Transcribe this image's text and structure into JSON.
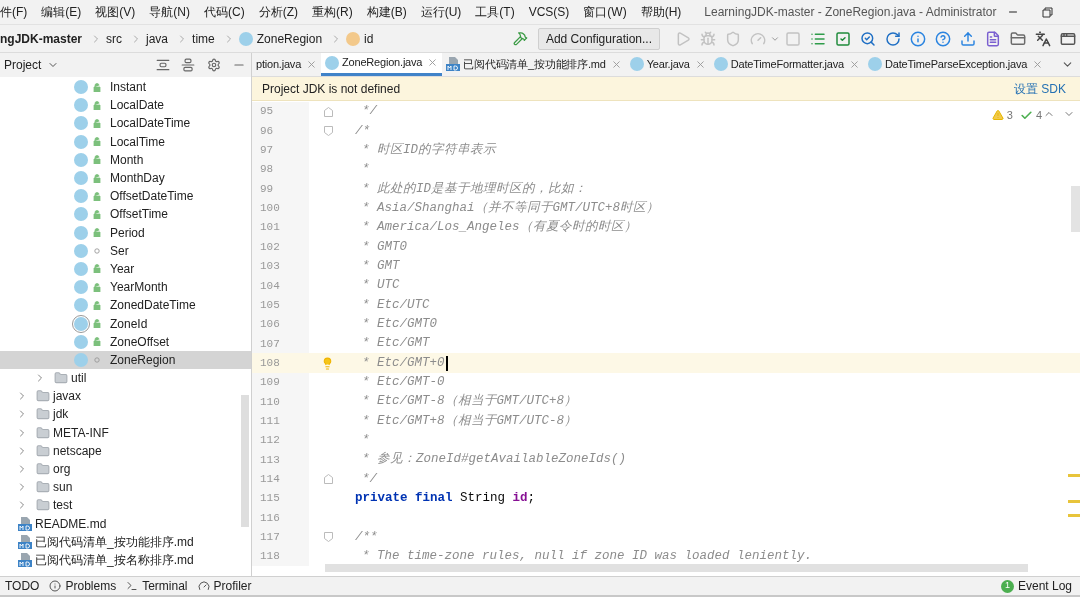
{
  "menu": [
    "件(F)",
    "编辑(E)",
    "视图(V)",
    "导航(N)",
    "代码(C)",
    "分析(Z)",
    "重构(R)",
    "构建(B)",
    "运行(U)",
    "工具(T)",
    "VCS(S)",
    "窗口(W)",
    "帮助(H)"
  ],
  "window": {
    "title": "LearningJDK-master - ZoneRegion.java - Administrator"
  },
  "breadcrumbs": [
    {
      "label": "ngJDK-master",
      "kind": "project"
    },
    {
      "label": "src",
      "kind": "dir"
    },
    {
      "label": "java",
      "kind": "dir"
    },
    {
      "label": "time",
      "kind": "dir"
    },
    {
      "label": "ZoneRegion",
      "kind": "class"
    },
    {
      "label": "id",
      "kind": "field"
    }
  ],
  "toolbar": {
    "config_button": "Add Configuration...",
    "tools": [
      {
        "kind": "run",
        "disabled": true
      },
      {
        "kind": "debug",
        "disabled": true
      },
      {
        "kind": "coverage",
        "disabled": true
      },
      {
        "kind": "profile",
        "disabled": true
      },
      {
        "kind": "stop",
        "disabled": true
      },
      {
        "kind": "list",
        "disabled": false
      },
      {
        "kind": "check",
        "disabled": false
      },
      {
        "kind": "inspect",
        "disabled": false
      },
      {
        "kind": "refresh",
        "disabled": false
      },
      {
        "kind": "info",
        "disabled": false
      },
      {
        "kind": "help",
        "disabled": false
      },
      {
        "kind": "upload",
        "disabled": false
      },
      {
        "kind": "doc",
        "disabled": false
      },
      {
        "kind": "folder",
        "disabled": false
      },
      {
        "kind": "translate",
        "disabled": false
      },
      {
        "kind": "terminal",
        "disabled": false
      }
    ]
  },
  "project_panel": {
    "title": "Project",
    "classes": [
      {
        "label": "Instant",
        "kind": "class",
        "public": true,
        "selected": false
      },
      {
        "label": "LocalDate",
        "kind": "class",
        "public": true,
        "selected": false
      },
      {
        "label": "LocalDateTime",
        "kind": "class",
        "public": true,
        "selected": false
      },
      {
        "label": "LocalTime",
        "kind": "class",
        "public": true,
        "selected": false
      },
      {
        "label": "Month",
        "kind": "enum",
        "public": true,
        "selected": false
      },
      {
        "label": "MonthDay",
        "kind": "class",
        "public": true,
        "selected": false
      },
      {
        "label": "OffsetDateTime",
        "kind": "class",
        "public": true,
        "selected": false
      },
      {
        "label": "OffsetTime",
        "kind": "class",
        "public": true,
        "selected": false
      },
      {
        "label": "Period",
        "kind": "class",
        "public": true,
        "selected": false
      },
      {
        "label": "Ser",
        "kind": "class",
        "public": false,
        "selected": false
      },
      {
        "label": "Year",
        "kind": "class",
        "public": true,
        "selected": false
      },
      {
        "label": "YearMonth",
        "kind": "class",
        "public": true,
        "selected": false
      },
      {
        "label": "ZonedDateTime",
        "kind": "class",
        "public": true,
        "selected": false
      },
      {
        "label": "ZoneId",
        "kind": "abstract",
        "public": true,
        "selected": false
      },
      {
        "label": "ZoneOffset",
        "kind": "class",
        "public": true,
        "selected": false
      },
      {
        "label": "ZoneRegion",
        "kind": "class",
        "public": false,
        "selected": true
      }
    ],
    "sub_folders": [
      {
        "label": "util",
        "expanded": false
      }
    ],
    "folders": [
      {
        "label": "javax",
        "expanded": false
      },
      {
        "label": "jdk",
        "expanded": false
      },
      {
        "label": "META-INF",
        "expanded": false
      },
      {
        "label": "netscape",
        "expanded": false
      },
      {
        "label": "org",
        "expanded": false
      },
      {
        "label": "sun",
        "expanded": false
      },
      {
        "label": "test",
        "expanded": false
      }
    ],
    "files": [
      "README.md",
      "已阅代码清单_按功能排序.md",
      "已阅代码清单_按名称排序.md"
    ]
  },
  "tabs": [
    {
      "label": "ption.java",
      "selected": false
    },
    {
      "label": "ZoneRegion.java",
      "kind": "class",
      "selected": true
    },
    {
      "label": "已阅代码清单_按功能排序.md",
      "kind": "md",
      "selected": false
    },
    {
      "label": "Year.java",
      "kind": "class",
      "selected": false
    },
    {
      "label": "DateTimeFormatter.java",
      "kind": "class",
      "selected": false
    },
    {
      "label": "DateTimeParseException.java",
      "kind": "class",
      "selected": false
    }
  ],
  "banner": {
    "message": "Project JDK is not defined",
    "action": "设置 SDK"
  },
  "inspections": {
    "warnings": "3",
    "weak_warnings": "4"
  },
  "lines": [
    {
      "number": "95",
      "kind": "comment",
      "fold_start": false,
      "fold_end": true,
      "current": false,
      "text": "*/"
    },
    {
      "number": "96",
      "kind": "comment_open",
      "fold_start": true,
      "fold_end": false,
      "current": false,
      "text": "/*"
    },
    {
      "number": "97",
      "kind": "comment",
      "fold_start": false,
      "fold_end": false,
      "current": false,
      "text": "* 时区ID的字符串表示"
    },
    {
      "number": "98",
      "kind": "comment",
      "fold_start": false,
      "fold_end": false,
      "current": false,
      "text": "*"
    },
    {
      "number": "99",
      "kind": "comment",
      "fold_start": false,
      "fold_end": false,
      "current": false,
      "text": "* 此处的ID是基于地理时区的，比如："
    },
    {
      "number": "100",
      "kind": "comment",
      "fold_start": false,
      "fold_end": false,
      "current": false,
      "text": "* Asia/Shanghai（并不等同于GMT/UTC+8时区）"
    },
    {
      "number": "101",
      "kind": "comment",
      "fold_start": false,
      "fold_end": false,
      "current": false,
      "text": "* America/Los_Angeles（有夏令时的时区）"
    },
    {
      "number": "102",
      "kind": "comment",
      "fold_start": false,
      "fold_end": false,
      "current": false,
      "text": "* GMT0"
    },
    {
      "number": "103",
      "kind": "comment",
      "fold_start": false,
      "fold_end": false,
      "current": false,
      "text": "* GMT"
    },
    {
      "number": "104",
      "kind": "comment",
      "fold_start": false,
      "fold_end": false,
      "current": false,
      "text": "* UTC"
    },
    {
      "number": "105",
      "kind": "comment",
      "fold_start": false,
      "fold_end": false,
      "current": false,
      "text": "* Etc/UTC"
    },
    {
      "number": "106",
      "kind": "comment",
      "fold_start": false,
      "fold_end": false,
      "current": false,
      "text": "* Etc/GMT0"
    },
    {
      "number": "107",
      "kind": "comment",
      "fold_start": false,
      "fold_end": false,
      "current": false,
      "text": "* Etc/GMT"
    },
    {
      "number": "108",
      "kind": "comment",
      "fold_start": false,
      "fold_end": false,
      "current": true,
      "text": "* Etc/GMT+0"
    },
    {
      "number": "109",
      "kind": "comment",
      "fold_start": false,
      "fold_end": false,
      "current": false,
      "text": "* Etc/GMT-0"
    },
    {
      "number": "110",
      "kind": "comment",
      "fold_start": false,
      "fold_end": false,
      "current": false,
      "text": "* Etc/GMT-8（相当于GMT/UTC+8）"
    },
    {
      "number": "111",
      "kind": "comment",
      "fold_start": false,
      "fold_end": false,
      "current": false,
      "text": "* Etc/GMT+8（相当于GMT/UTC-8）"
    },
    {
      "number": "112",
      "kind": "comment",
      "fold_start": false,
      "fold_end": false,
      "current": false,
      "text": "*"
    },
    {
      "number": "113",
      "kind": "comment",
      "fold_start": false,
      "fold_end": false,
      "current": false,
      "text": "* 参见：ZoneId#getAvailableZoneIds()"
    },
    {
      "number": "114",
      "kind": "comment",
      "fold_start": false,
      "fold_end": true,
      "current": false,
      "text": "*/"
    },
    {
      "number": "115",
      "kind": "code",
      "fold_start": false,
      "fold_end": false,
      "current": false,
      "tokens": [
        {
          "text": "private final ",
          "kind": "keyword"
        },
        {
          "text": "String ",
          "kind": "plain"
        },
        {
          "text": "id",
          "kind": "field"
        },
        {
          "text": ";",
          "kind": "plain"
        }
      ]
    },
    {
      "number": "116",
      "kind": "code",
      "fold_start": false,
      "fold_end": false,
      "current": false
    },
    {
      "number": "117",
      "kind": "comment_open",
      "fold_start": true,
      "fold_end": false,
      "current": false,
      "text": "/**"
    },
    {
      "number": "118",
      "kind": "comment",
      "fold_start": false,
      "fold_end": false,
      "current": false,
      "text": "* The time-zone rules, null if zone ID was loaded leniently."
    }
  ],
  "status_bar": {
    "tools": [
      {
        "label": "TODO",
        "kind": "todo"
      },
      {
        "label": "Problems",
        "kind": "problems"
      },
      {
        "label": "Terminal",
        "kind": "terminal"
      },
      {
        "label": "Profiler",
        "kind": "profiler"
      }
    ],
    "event_log": {
      "label": "Event Log",
      "count": "1"
    }
  }
}
